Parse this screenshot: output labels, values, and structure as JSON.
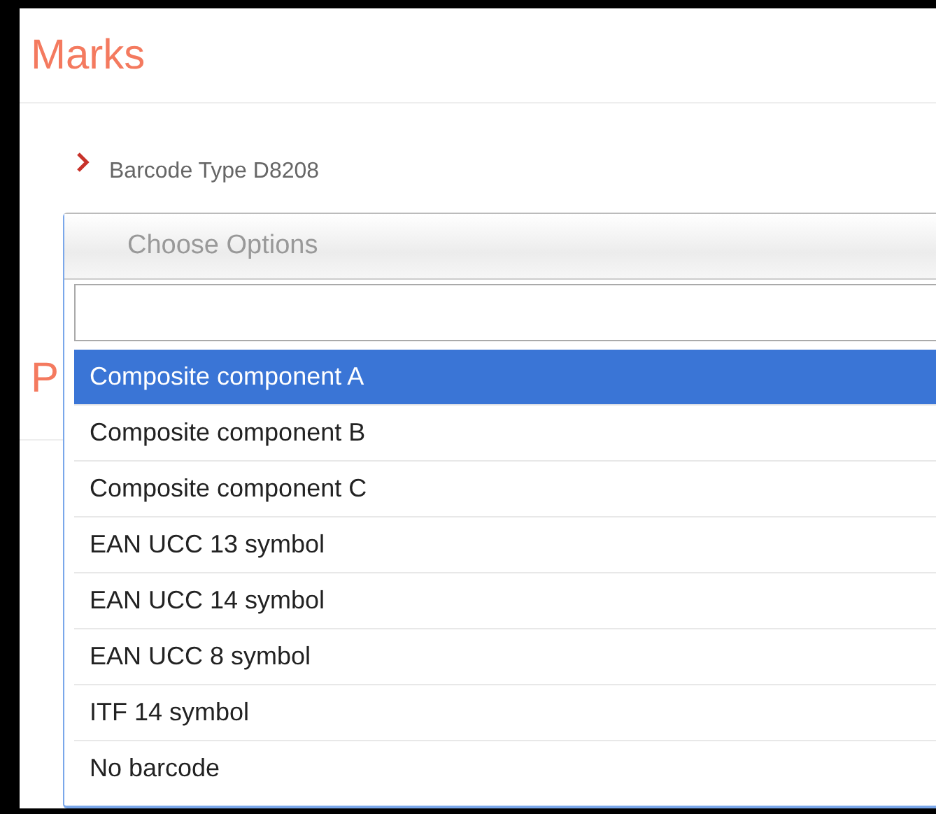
{
  "section_title": "Marks",
  "field": {
    "label": "Barcode Type D8208"
  },
  "next_section_title": "P",
  "dropdown": {
    "header": "Choose Options",
    "options": [
      {
        "label": "Composite component A",
        "selected": true
      },
      {
        "label": "Composite component B",
        "selected": false
      },
      {
        "label": "Composite component C",
        "selected": false
      },
      {
        "label": "EAN UCC 13 symbol",
        "selected": false
      },
      {
        "label": "EAN UCC 14 symbol",
        "selected": false
      },
      {
        "label": "EAN UCC 8 symbol",
        "selected": false
      },
      {
        "label": "ITF 14 symbol",
        "selected": false
      },
      {
        "label": "No barcode",
        "selected": false
      }
    ]
  }
}
